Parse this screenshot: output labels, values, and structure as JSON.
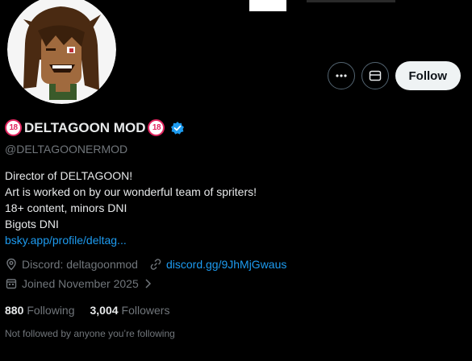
{
  "profile": {
    "display_name": "DELTAGOON MOD",
    "name_badge": "18",
    "handle": "@DELTAGOONERMOD",
    "verified": true,
    "bio": [
      "Director of DELTAGOON!",
      "Art is worked on by our wonderful team of spriters!",
      "18+ content, minors DNI",
      "Bigots DNI"
    ],
    "bio_link": "bsky.app/profile/deltag...",
    "location": "Discord: deltagoonmod",
    "website": "discord.gg/9JhMjGwaus",
    "joined": "Joined November 2025",
    "following_count": "880",
    "following_label": "Following",
    "followers_count": "3,004",
    "followers_label": "Followers",
    "not_followed_text": "Not followed by anyone you’re following"
  },
  "actions": {
    "more_icon": "more-dots-icon",
    "message_icon": "envelope-icon",
    "follow_label": "Follow"
  },
  "colors": {
    "background": "#000000",
    "text": "#e7e9ea",
    "muted": "#71767b",
    "link": "#1d9bf0",
    "badge": "#e0245e",
    "follow_bg": "#eff3f4"
  }
}
